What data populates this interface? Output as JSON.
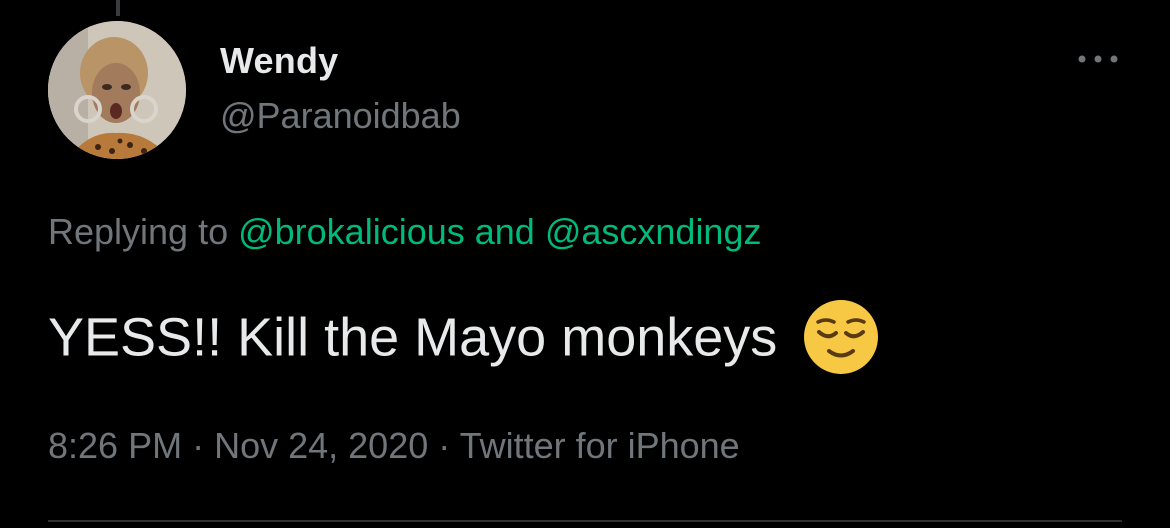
{
  "tweet": {
    "author": {
      "name": "Wendy",
      "handle": "@Paranoidbab"
    },
    "replying": {
      "prefix": "Replying to ",
      "mention1": "@brokalicious",
      "conjunction": " and ",
      "mention2": "@ascxndingz"
    },
    "text": "YESS!! Kill the Mayo monkeys",
    "emoji": "relieved-face-emoji",
    "meta": {
      "time": "8:26 PM",
      "separator1": " · ",
      "date": "Nov 24, 2020",
      "separator2": " · ",
      "source": "Twitter for iPhone"
    }
  },
  "colors": {
    "background": "#000000",
    "primary_text": "#e7e9ea",
    "secondary_text": "#71767b",
    "mention": "#00ba7c",
    "divider": "#2f3336"
  }
}
